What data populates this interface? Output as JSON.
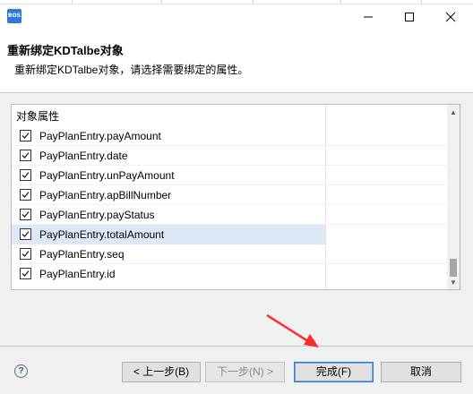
{
  "window": {
    "app_icon": "BOS",
    "controls": [
      "minimize-icon",
      "maximize-icon",
      "close-icon"
    ]
  },
  "header": {
    "title": "重新绑定KDTalbe对象",
    "description": "重新绑定KDTalbe对象，请选择需要绑定的属性。"
  },
  "table": {
    "column_header": "对象属性",
    "rows": [
      {
        "label": "PayPlanEntry.payAmount",
        "checked": true,
        "selected": false
      },
      {
        "label": "PayPlanEntry.date",
        "checked": true,
        "selected": false
      },
      {
        "label": "PayPlanEntry.unPayAmount",
        "checked": true,
        "selected": false
      },
      {
        "label": "PayPlanEntry.apBillNumber",
        "checked": true,
        "selected": false
      },
      {
        "label": "PayPlanEntry.payStatus",
        "checked": true,
        "selected": false
      },
      {
        "label": "PayPlanEntry.totalAmount",
        "checked": true,
        "selected": true
      },
      {
        "label": "PayPlanEntry.seq",
        "checked": true,
        "selected": false
      },
      {
        "label": "PayPlanEntry.id",
        "checked": true,
        "selected": false
      }
    ]
  },
  "footer": {
    "help": "?",
    "back_label": "< 上一步(B)",
    "next_label": "下一步(N) >",
    "finish_label": "完成(F)",
    "cancel_label": "取消"
  },
  "colors": {
    "accent": "#2f79d4",
    "annotation_arrow": "#ff2a2a",
    "selected_row": "#dde9f6"
  }
}
